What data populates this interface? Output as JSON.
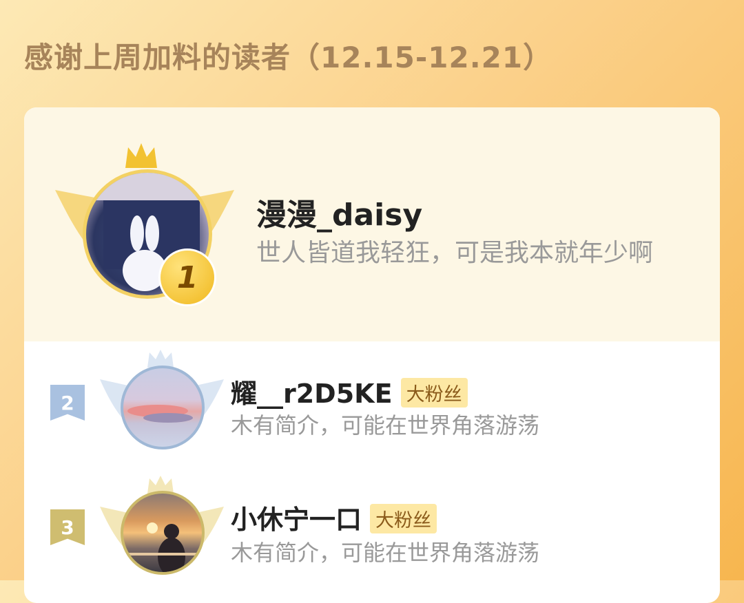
{
  "header": {
    "title": "感谢上周加料的读者（12.15-12.21）"
  },
  "readers": [
    {
      "rank": "1",
      "name": "漫漫_daisy",
      "bio": "世人皆道我轻狂，可是我本就年少啊",
      "badge": ""
    },
    {
      "rank": "2",
      "name": "耀__r2D5KE",
      "bio": "木有简介，可能在世界角落游荡",
      "badge": "大粉丝"
    },
    {
      "rank": "3",
      "name": "小休宁一口",
      "bio": "木有简介，可能在世界角落游荡",
      "badge": "大粉丝"
    }
  ],
  "colors": {
    "gold": "#f2c232",
    "silver": "#9fb8d6",
    "bronze": "#d2bf72"
  }
}
